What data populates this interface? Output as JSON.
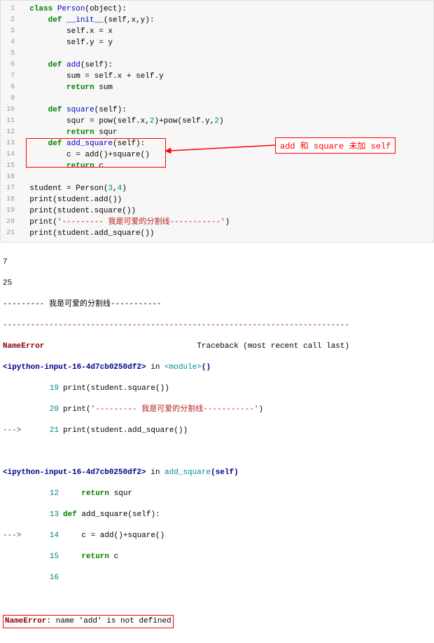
{
  "code": {
    "l1": {
      "a": "class ",
      "b": "Person",
      "c": "(",
      "d": "object",
      "e": "):"
    },
    "l2": {
      "a": "def ",
      "b": "__init__",
      "c": "(",
      "d": "self",
      "e": ",x,y):"
    },
    "l3": {
      "a": "self",
      "b": ".x = x"
    },
    "l4": {
      "a": "self",
      "b": ".y = y"
    },
    "l6": {
      "a": "def ",
      "b": "add",
      "c": "(",
      "d": "self",
      "e": "):"
    },
    "l7": {
      "a": "sum",
      "b": " = ",
      "c": "self",
      "d": ".x + ",
      "e": "self",
      "f": ".y"
    },
    "l8": {
      "a": "return ",
      "b": "sum"
    },
    "l10": {
      "a": "def ",
      "b": "square",
      "c": "(",
      "d": "self",
      "e": "):"
    },
    "l11": {
      "a": "squr = ",
      "b": "pow",
      "c": "(",
      "d": "self",
      "e": ".x,",
      "f": "2",
      "g": ")+",
      "h": "pow",
      "i": "(",
      "j": "self",
      "k": ".y,",
      "l": "2",
      "m": ")"
    },
    "l12": {
      "a": "return ",
      "b": "squr"
    },
    "l13": {
      "a": "def ",
      "b": "add_square",
      "c": "(",
      "d": "self",
      "e": "):"
    },
    "l14": {
      "a": "c = add()+square()"
    },
    "l15": {
      "a": "return ",
      "b": "c"
    },
    "l17": {
      "a": "student = Person(",
      "b": "3",
      "c": ",",
      "d": "4",
      "e": ")"
    },
    "l18": {
      "a": "print",
      "b": "(student.add())"
    },
    "l19": {
      "a": "print",
      "b": "(student.square())"
    },
    "l20": {
      "a": "print",
      "b": "(",
      "c": "'--------- 我是可爱的分割线-----------'",
      "d": ")"
    },
    "l21": {
      "a": "print",
      "b": "(student.add_square())"
    }
  },
  "ln": {
    "1": "1",
    "2": "2",
    "3": "3",
    "4": "4",
    "5": "5",
    "6": "6",
    "7": "7",
    "8": "8",
    "9": "9",
    "10": "10",
    "11": "11",
    "12": "12",
    "13": "13",
    "14": "14",
    "15": "15",
    "16": "16",
    "17": "17",
    "18": "18",
    "19": "19",
    "20": "20",
    "21": "21"
  },
  "annotation": "add 和 square 未加 self",
  "output": {
    "v1": "7",
    "v2": "25",
    "v3": "--------- 我是可爱的分割线-----------",
    "sep": "---------------------------------------------------------------------------",
    "err_name": "NameError",
    "tb_label": "Traceback (most recent call last)",
    "mod1": "<ipython-input-16-4d7cb0250df2>",
    "in": " in ",
    "mod2": "<module>",
    "paren": "()",
    "t19": {
      "n": "19",
      "a": "print",
      "b": "(student.square())"
    },
    "t20": {
      "n": "20",
      "a": "print",
      "b": "(",
      "c": "'--------- 我是可爱的分割线-----------'",
      "d": ")"
    },
    "t21": {
      "n": "21",
      "arr": "---> ",
      "a": "print",
      "b": "(student.add_square())"
    },
    "fn2": "add_square",
    "fn2a": "(self)",
    "t12": {
      "n": "12",
      "a": "return ",
      "b": "squr"
    },
    "t13": {
      "n": "13",
      "a": "def ",
      "b": "add_square",
      "c": "(",
      "d": "self",
      "e": "):"
    },
    "t14": {
      "n": "14",
      "arr": "---> ",
      "a": "c = add()+square()"
    },
    "t15": {
      "n": "15",
      "a": "return ",
      "b": "c"
    },
    "t16": {
      "n": "16"
    },
    "final_err": "NameError",
    "final_msg": ": name 'add' is not defined"
  }
}
